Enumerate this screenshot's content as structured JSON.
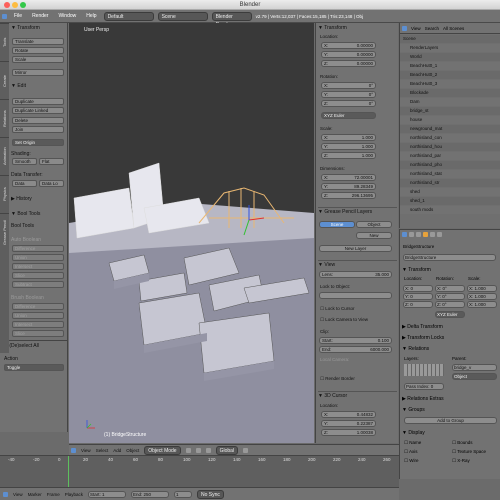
{
  "window": {
    "title": "Blender"
  },
  "menu": {
    "file": "File",
    "render": "Render",
    "window": "Window",
    "help": "Help",
    "layout": "Default",
    "scene": "Scene",
    "engine": "Blender Render",
    "stats": "v2.79 | Verts:12,037 | Faces:15,185 | Tris:23,148 | Obj"
  },
  "left": {
    "tabs": [
      "Tools",
      "Create",
      "Relations",
      "Animation",
      "Physics",
      "Grease Pencil"
    ],
    "transform_header": "▼ Transform",
    "translate": "Translate",
    "rotate": "Rotate",
    "scale": "Scale",
    "mirror": "Mirror",
    "edit_header": "▼ Edit",
    "duplicate": "Duplicate",
    "duplicate_linked": "Duplicate Linked",
    "delete": "Delete",
    "join": "Join",
    "set_origin": "Set Origin",
    "shading": "Shading:",
    "smooth": "Smooth",
    "flat": "Flat",
    "data_transfer": "Data Transfer:",
    "data": "Data",
    "data_lo": "Data Lo",
    "history": "▶ History",
    "bool_tools": "▼ Bool Tools",
    "bool_tools_label": "Bool Tools",
    "auto_boolean": "Auto Boolean",
    "difference": "Difference",
    "union": "Union",
    "intersect": "Intersect",
    "slice": "Slice",
    "subtract": "Subtract",
    "brush_boolean": "Brush Boolean",
    "op_header": "▼ (De)select All",
    "action": "Action",
    "toggle": "Toggle"
  },
  "viewport": {
    "label": "User Persp",
    "object_label": "(1) BridgeStructure"
  },
  "npanel": {
    "transform": "▼ Transform",
    "location": "Location:",
    "lx": "0.00000",
    "ly": "0.00000",
    "lz": "0.00000",
    "rotation": "Rotation:",
    "rx": "0°",
    "ry": "0°",
    "rz": "0°",
    "euler": "XYZ Euler",
    "scale": "Scale:",
    "sx": "1.000",
    "sy": "1.000",
    "sz": "1.000",
    "dimensions": "Dimensions:",
    "dx": "72.00001",
    "dy": "89.28349",
    "dz": "296.13695",
    "grease": "▼ Grease Pencil Layers",
    "scene_tab": "Scene",
    "object_tab": "Object",
    "new": "New",
    "new_layer": "New Layer",
    "view": "▼ View",
    "lens": "Lens:",
    "lens_val": "35.000",
    "lock_obj": "Lock to Object:",
    "lock_cursor": "Lock to Cursor",
    "lock_cam": "Lock Camera to View",
    "clip": "Clip:",
    "start": "Start:",
    "start_val": "0.100",
    "end": "End:",
    "end_val": "6000.000",
    "local_cam": "Local Camera:",
    "render_border": "Render Border",
    "cursor": "▼ 3D Cursor",
    "cloc": "Location:",
    "cx": "0.44832",
    "cy": "0.22387",
    "cz": "1.00038"
  },
  "outliner": {
    "view": "View",
    "search": "Search",
    "all": "All Scenes",
    "rows": [
      "Scene",
      "RenderLayers",
      "World",
      "BeachHut0_1",
      "BeachHut0_2",
      "BeachHut0_3",
      "Blockade",
      "Dam",
      "bridge_st",
      "house",
      "newground_mat",
      "northisland_con",
      "northisland_hou",
      "northisland_par",
      "northisland_pho",
      "northisland_stat",
      "northisland_str",
      "shed",
      "shed_1",
      "south mods"
    ]
  },
  "props": {
    "breadcrumb": "BridgeStructure",
    "name": "BridgeStructure",
    "transform": "▼ Transform",
    "location": "Location:",
    "rotation": "Rotation:",
    "scale": "Scale:",
    "x": "X: 0",
    "y": "Y: 0",
    "z": "Z: 0",
    "rx": "X: 0°",
    "ry": "Y: 0°",
    "rz": "Z: 0°",
    "s": "X: 1.000",
    "euler": "XYZ Euler",
    "delta": "▶ Delta Transform",
    "locks": "▶ Transform Locks",
    "relations": "▼ Relations",
    "layers": "Layers:",
    "parent": "Parent:",
    "parent_val": "bridge_v",
    "object": "Object",
    "pass_index": "Pass Index: 0",
    "rel_extras": "▶ Relations Extras",
    "groups": "▼ Groups",
    "add_group": "Add to Group",
    "display": "▼ Display",
    "name_chk": "Name",
    "axis_chk": "Axis",
    "bounds": "Bounds",
    "texspace": "Texture Space",
    "wire": "Wire",
    "xray": "X-Ray"
  },
  "footer": {
    "view": "View",
    "select": "Select",
    "add": "Add",
    "object": "Object",
    "mode": "Object Mode",
    "pivot": "Global"
  },
  "timeline": {
    "ticks": [
      "-40",
      "-20",
      "0",
      "20",
      "40",
      "60",
      "80",
      "100",
      "120",
      "140",
      "160",
      "180",
      "200",
      "220",
      "240",
      "260"
    ],
    "view": "View",
    "marker": "Marker",
    "frame": "Frame",
    "playback": "Playback",
    "start": "Start:",
    "start_val": "1",
    "end": "End:",
    "end_val": "250",
    "current": "1",
    "nosync": "No Sync"
  }
}
